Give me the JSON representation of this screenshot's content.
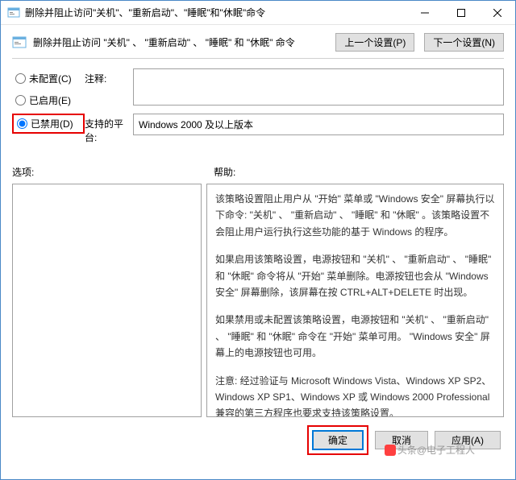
{
  "title": "删除并阻止访问\"关机\"、\"重新启动\"、\"睡眠\"和\"休眠\"命令",
  "header": "删除并阻止访问 \"关机\" 、 \"重新启动\" 、 \"睡眠\" 和 \"休眠\" 命令",
  "nav": {
    "prev": "上一个设置(P)",
    "next": "下一个设置(N)"
  },
  "radio": {
    "notconf": "未配置(C)",
    "enabled": "已启用(E)",
    "disabled": "已禁用(D)"
  },
  "fields": {
    "comment": "注释:",
    "platform": "支持的平台:",
    "platformVal": "Windows 2000 及以上版本"
  },
  "labels": {
    "options": "选项:",
    "help": "帮助:"
  },
  "help": {
    "p1": "该策略设置阻止用户从 \"开始\" 菜单或 \"Windows 安全\" 屏幕执行以下命令: \"关机\" 、 \"重新启动\" 、 \"睡眠\" 和 \"休眠\" 。该策略设置不会阻止用户运行执行这些功能的基于 Windows 的程序。",
    "p2": "如果启用该策略设置，电源按钮和 \"关机\" 、 \"重新启动\" 、 \"睡眠\" 和 \"休眠\" 命令将从 \"开始\" 菜单删除。电源按钮也会从 \"Windows 安全\" 屏幕删除，该屏幕在按 CTRL+ALT+DELETE 时出现。",
    "p3": "如果禁用或未配置该策略设置，电源按钮和 \"关机\" 、 \"重新启动\" 、 \"睡眠\" 和 \"休眠\" 命令在 \"开始\" 菜单可用。 \"Windows 安全\" 屏幕上的电源按钮也可用。",
    "p4": "注意: 经过验证与 Microsoft Windows Vista、Windows XP SP2、Windows XP SP1、Windows XP 或 Windows 2000 Professional 兼容的第三方程序也要求支持该策略设置。"
  },
  "buttons": {
    "ok": "确定",
    "cancel": "取消",
    "apply": "应用(A)"
  },
  "watermark": "头条@电子工程人"
}
